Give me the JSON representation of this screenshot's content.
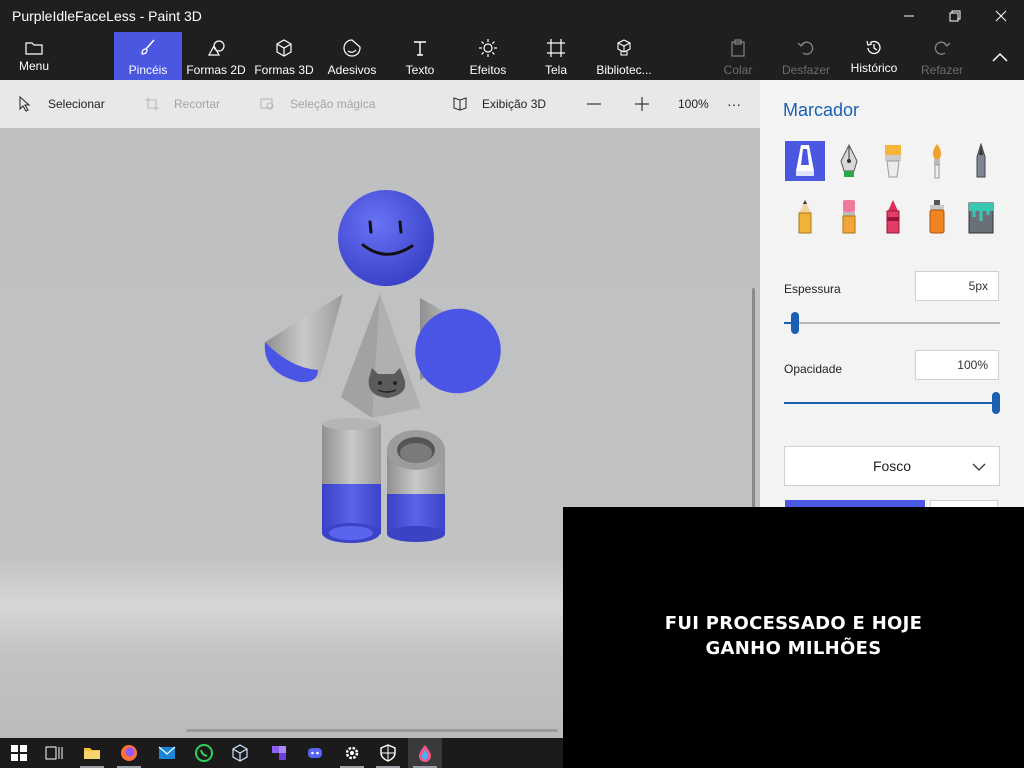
{
  "window": {
    "title": "PurpleIdleFaceLess - Paint 3D"
  },
  "ribbon": {
    "tabs": [
      {
        "label": "Menu"
      },
      {
        "label": "Pincéis"
      },
      {
        "label": "Formas 2D"
      },
      {
        "label": "Formas 3D"
      },
      {
        "label": "Adesivos"
      },
      {
        "label": "Texto"
      },
      {
        "label": "Efeitos"
      },
      {
        "label": "Tela"
      },
      {
        "label": "Bibliotec..."
      }
    ],
    "actions": [
      {
        "label": "Colar"
      },
      {
        "label": "Desfazer"
      },
      {
        "label": "Histórico"
      },
      {
        "label": "Refazer"
      }
    ]
  },
  "toolbar": {
    "select": "Selecionar",
    "crop": "Recortar",
    "magic_select": "Seleção mágica",
    "view3d": "Exibição 3D",
    "zoom": "100%",
    "more": "···"
  },
  "panel": {
    "title": "Marcador",
    "thickness_label": "Espessura",
    "thickness_value": "5px",
    "thickness_fraction": 0.05,
    "opacity_label": "Opacidade",
    "opacity_value": "100%",
    "opacity_fraction": 1.0,
    "finish": "Fosco"
  },
  "overlay": {
    "line1": "FUI PROCESSADO E HOJE",
    "line2": "GANHO MILHÕES"
  },
  "colors": {
    "accent": "#4a57e0",
    "panel_blue": "#1b5fb3",
    "model_blue": "#4a55e6"
  }
}
